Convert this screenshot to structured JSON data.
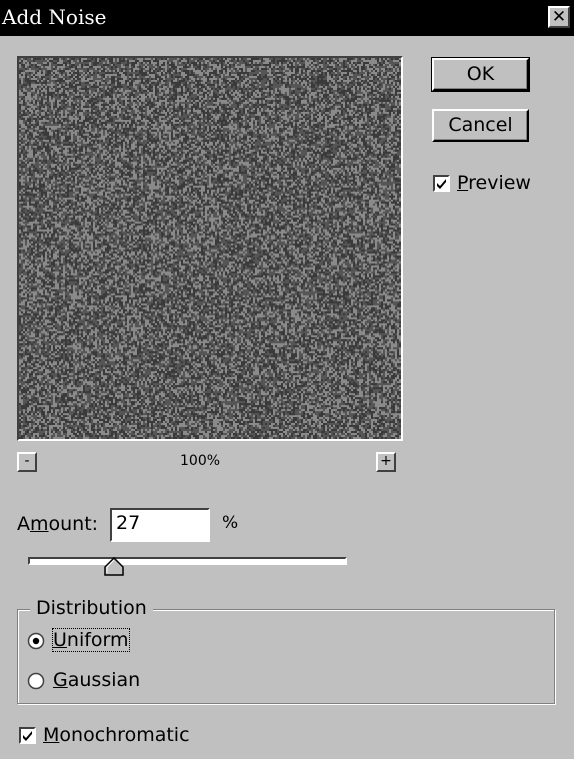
{
  "window": {
    "title": "Add Noise",
    "close_glyph": "✕"
  },
  "buttons": {
    "ok": "OK",
    "cancel": "Cancel"
  },
  "preview_checkbox": {
    "label_first": "P",
    "label_rest": "review",
    "checked": true
  },
  "zoom": {
    "minus": "-",
    "plus": "+",
    "level": "100%"
  },
  "amount": {
    "label_a": "A",
    "label_m": "m",
    "label_rest": "ount:",
    "value": "27",
    "unit": "%",
    "slider_fraction": 0.27
  },
  "distribution": {
    "legend": "Distribution",
    "options": [
      {
        "first": "U",
        "rest": "niform",
        "selected": true
      },
      {
        "first": "G",
        "rest": "aussian",
        "selected": false
      }
    ]
  },
  "monochromatic": {
    "label_first": "M",
    "label_rest": "onochromatic",
    "checked": true
  },
  "colors": {
    "dialog_bg": "#c0c0c0",
    "titlebar_bg": "#000000",
    "noise_dark": "#3a3a3a",
    "noise_light": "#8a8a8a"
  }
}
